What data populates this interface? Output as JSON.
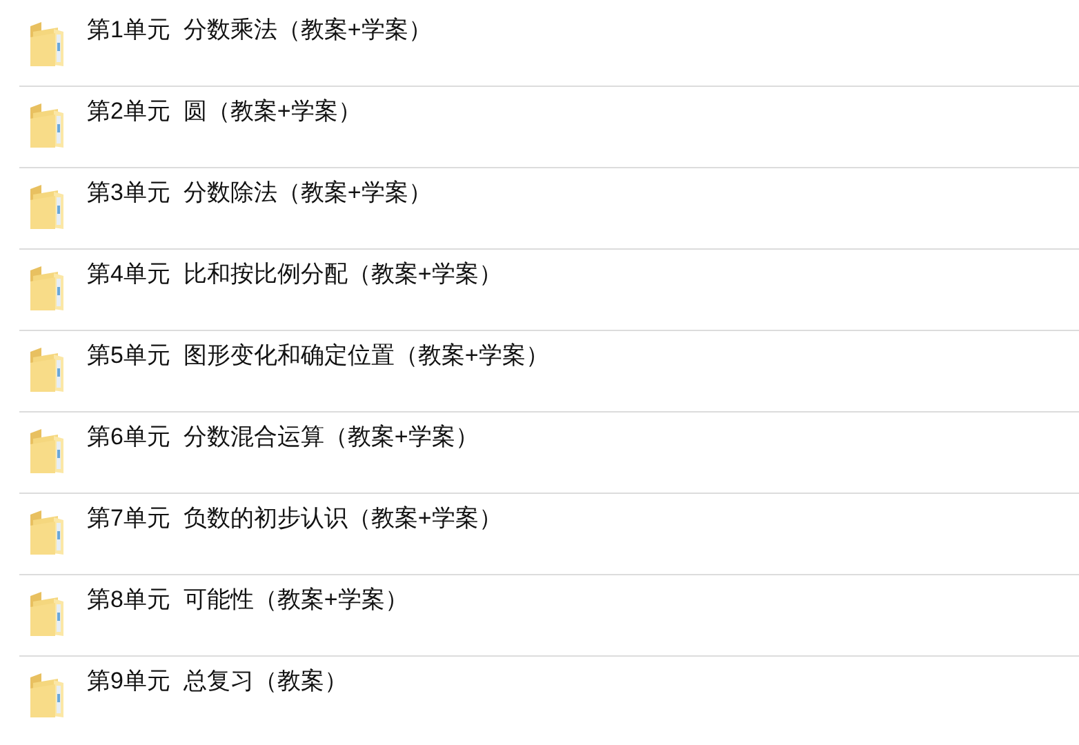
{
  "folders": [
    {
      "name": "第1单元  分数乘法（教案+学案）"
    },
    {
      "name": "第2单元  圆（教案+学案）"
    },
    {
      "name": "第3单元  分数除法（教案+学案）"
    },
    {
      "name": "第4单元  比和按比例分配（教案+学案）"
    },
    {
      "name": "第5单元  图形变化和确定位置（教案+学案）"
    },
    {
      "name": "第6单元  分数混合运算（教案+学案）"
    },
    {
      "name": "第7单元  负数的初步认识（教案+学案）"
    },
    {
      "name": "第8单元  可能性（教案+学案）"
    },
    {
      "name": "第9单元  总复习（教案）"
    }
  ]
}
